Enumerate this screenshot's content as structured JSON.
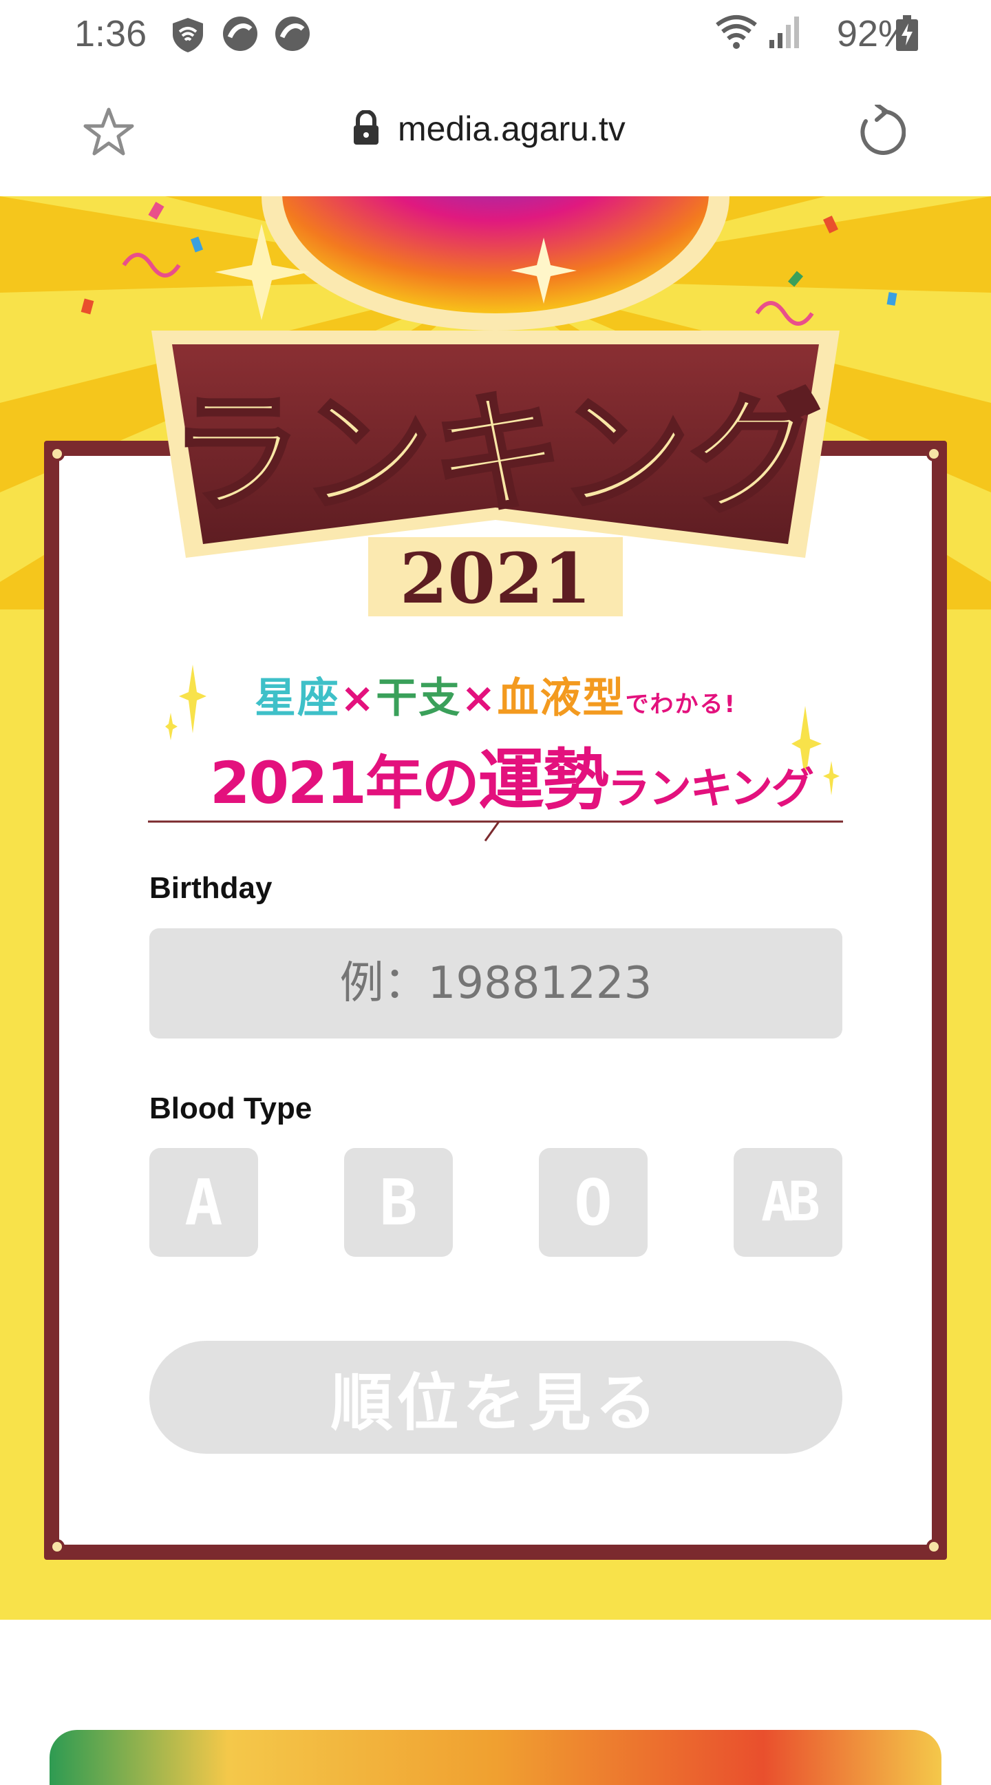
{
  "status_bar": {
    "time": "1:36",
    "battery": "92%",
    "icons": [
      "shield-wifi-icon",
      "notification-icon",
      "notification-icon",
      "wifi-icon",
      "signal-icon",
      "battery-charging-icon"
    ]
  },
  "browser": {
    "url": "media.agaru.tv",
    "icons": [
      "star-icon",
      "lock-icon",
      "reload-icon"
    ]
  },
  "banner": {
    "title": "ランキング",
    "year": "2021",
    "subtitle_line1": [
      "星座",
      "×",
      "干支",
      "×",
      "血液型",
      "でわかる!"
    ],
    "subtitle_line2": [
      "2021年の",
      "運勢",
      "ランキング"
    ]
  },
  "form": {
    "birthday_label": "Birthday",
    "birthday_placeholder": "例：19881223",
    "blood_type_label": "Blood Type",
    "blood_types": [
      "A",
      "B",
      "O",
      "AB"
    ],
    "submit_label": "順位を見る"
  },
  "colors": {
    "banner_bg": "#f8e24a",
    "frame": "#7b2a2e",
    "title_pink": "#e3117d",
    "disabled_gray": "#e1e1e1"
  }
}
